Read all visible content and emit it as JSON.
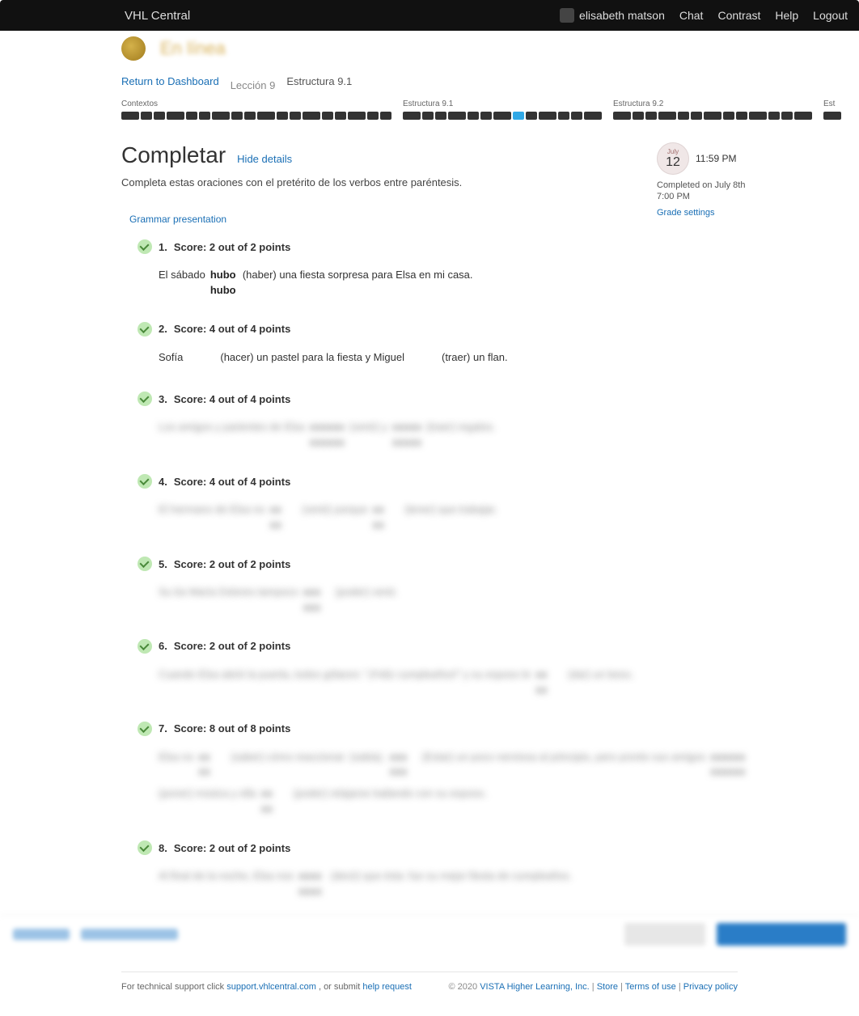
{
  "topbar": {
    "brand": "VHL Central",
    "username": "elisabeth matson",
    "chat": "Chat",
    "contrast": "Contrast",
    "help": "Help",
    "logout": "Logout"
  },
  "secbar": {
    "title": "En línea"
  },
  "crumbs": {
    "return": "Return to Dashboard",
    "lesson": "Lección 9",
    "leaf": "Estructura 9.1"
  },
  "progress": {
    "groups": [
      {
        "label": "Contextos",
        "boxes": 18,
        "activeIndex": -1
      },
      {
        "label": "Estructura 9.1",
        "boxes": 13,
        "activeIndex": 7
      },
      {
        "label": "Estructura 9.2",
        "boxes": 13,
        "activeIndex": -1
      },
      {
        "label": "Est",
        "boxes": 1,
        "activeIndex": -1
      }
    ]
  },
  "headline": {
    "title": "Completar",
    "hide": "Hide details",
    "instructions": "Completa estas oraciones con el pretérito de los verbos entre paréntesis."
  },
  "rightpanel": {
    "month": "July",
    "day": "12",
    "time": "11:59 PM",
    "status": "Completed on July 8th 7:00 PM",
    "grade_link": "Grade settings"
  },
  "grammar_link": "Grammar presentation",
  "questions": [
    {
      "num": "1.",
      "score": "Score: 2 out of 2 points",
      "blurred": false,
      "parts": [
        {
          "t": "text",
          "v": "El sábado"
        },
        {
          "t": "ans",
          "top": "hubo",
          "bottom": "hubo"
        },
        {
          "t": "text",
          "v": "(haber) una fiesta sorpresa para Elsa en mi casa."
        }
      ]
    },
    {
      "num": "2.",
      "score": "Score: 4 out of 4 points",
      "blurred": false,
      "parts": [
        {
          "t": "text",
          "v": "Sofía"
        },
        {
          "t": "ans",
          "top": " ",
          "bottom": " "
        },
        {
          "t": "text",
          "v": "(hacer) un pastel para la fiesta y Miguel"
        },
        {
          "t": "ans",
          "top": " ",
          "bottom": " "
        },
        {
          "t": "text",
          "v": "(traer) un flan."
        }
      ]
    },
    {
      "num": "3.",
      "score": "Score: 4 out of 4 points",
      "blurred": true,
      "parts": [
        {
          "t": "text",
          "v": "Los amigos y parientes de Elsa"
        },
        {
          "t": "ans",
          "top": "xxxxxx",
          "bottom": "xxxxxx"
        },
        {
          "t": "text",
          "v": "(venir) y"
        },
        {
          "t": "ans",
          "top": "xxxxx",
          "bottom": "xxxxx"
        },
        {
          "t": "text",
          "v": "(traer) regalos."
        }
      ]
    },
    {
      "num": "4.",
      "score": "Score: 4 out of 4 points",
      "blurred": true,
      "parts": [
        {
          "t": "text",
          "v": "El hermano de Elsa no"
        },
        {
          "t": "ans",
          "top": "xx",
          "bottom": "xx"
        },
        {
          "t": "text",
          "v": "(venir) porque"
        },
        {
          "t": "ans",
          "top": "xx",
          "bottom": "xx"
        },
        {
          "t": "text",
          "v": "(tener) que trabajar."
        }
      ]
    },
    {
      "num": "5.",
      "score": "Score: 2 out of 2 points",
      "blurred": true,
      "parts": [
        {
          "t": "text",
          "v": "Su tía María Dolores tampoco"
        },
        {
          "t": "ans",
          "top": "xxx",
          "bottom": "xxx"
        },
        {
          "t": "text",
          "v": "(poder) venir."
        }
      ]
    },
    {
      "num": "6.",
      "score": "Score: 2 out of 2 points",
      "blurred": true,
      "parts": [
        {
          "t": "text",
          "v": "Cuando Elsa abrió la puerta, todos gritaron: \"¡Feliz cumpleaños!\" y su esposo le"
        },
        {
          "t": "ans",
          "top": "xx",
          "bottom": "xx"
        },
        {
          "t": "text",
          "v": "(dar) un beso."
        }
      ]
    },
    {
      "num": "7.",
      "score": "Score: 8 out of 8 points",
      "blurred": true,
      "parts": [
        {
          "t": "text",
          "v": "Elsa no"
        },
        {
          "t": "ans",
          "top": "xx",
          "bottom": "xx"
        },
        {
          "t": "text",
          "v": "(saber) cómo reaccionar"
        },
        {
          "t": "text",
          "v": "(sabia)."
        },
        {
          "t": "ans",
          "top": "xxx",
          "bottom": "xxx"
        },
        {
          "t": "text",
          "v": "(Estar) un poco nerviosa al principio, pero pronto sus amigos"
        },
        {
          "t": "ans",
          "top": "xxxxxx",
          "bottom": "xxxxxx"
        },
        {
          "t": "text",
          "v": "(poner) música y ella"
        },
        {
          "t": "ans",
          "top": "xx",
          "bottom": "xx"
        },
        {
          "t": "text",
          "v": "(poder) relajarse bailando con su esposo."
        }
      ]
    },
    {
      "num": "8.",
      "score": "Score: 2 out of 2 points",
      "blurred": true,
      "parts": [
        {
          "t": "text",
          "v": "Al final de la noche, Elsa nos"
        },
        {
          "t": "ans",
          "top": "xxxx",
          "bottom": "xxxx"
        },
        {
          "t": "text",
          "v": "(decir) que ésta"
        },
        {
          "t": "text",
          "v": "fue su mejor fiesta de cumpleaños."
        }
      ]
    }
  ],
  "footer": {
    "left_pre": "For technical support click ",
    "support_link": "support.vhlcentral.com",
    "left_mid": ", or submit ",
    "help_link": "help request",
    "copyright": "© 2020 ",
    "company": "VISTA Higher Learning, Inc.",
    "sep": " | ",
    "store": "Store",
    "terms": "Terms of use",
    "privacy": "Privacy policy"
  }
}
